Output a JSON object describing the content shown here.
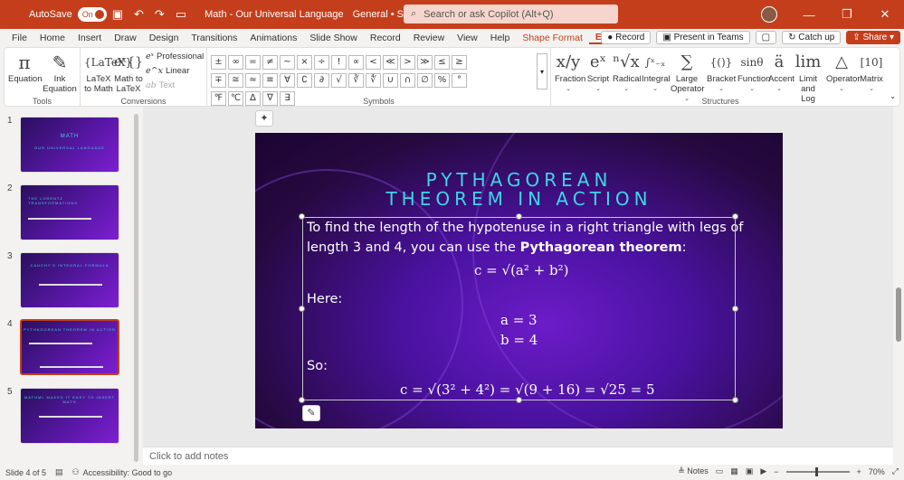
{
  "titlebar": {
    "autosave_label": "AutoSave",
    "autosave_state": "On",
    "doc_title": "Math - Our Universal Language",
    "sensitivity": "General • Saved",
    "search_placeholder": "Search or ask Copilot (Alt+Q)"
  },
  "tabs": [
    "File",
    "Home",
    "Insert",
    "Draw",
    "Design",
    "Transitions",
    "Animations",
    "Slide Show",
    "Record",
    "Review",
    "View",
    "Help",
    "Shape Format",
    "Equation"
  ],
  "active_tab": "Equation",
  "tab_actions": {
    "record": "Record",
    "teams": "Present in Teams",
    "catchup": "Catch up",
    "share": "Share"
  },
  "ribbon": {
    "tools": {
      "label": "Tools",
      "equation": "Equation",
      "ink_line1": "Ink",
      "ink_line2": "Equation"
    },
    "conversions": {
      "label": "Conversions",
      "latex_line1": "LaTeX",
      "latex_line2": "to Math",
      "mathtolatex_line1": "Math to",
      "mathtolatex_line2": "LaTeX",
      "professional": "Professional",
      "linear": "Linear",
      "text": "Text"
    },
    "symbols": {
      "label": "Symbols",
      "items": [
        "±",
        "∞",
        "=",
        "≠",
        "~",
        "×",
        "÷",
        "!",
        "∝",
        "<",
        "≪",
        ">",
        "≫",
        "≤",
        "≥",
        "∓",
        "≅",
        "≈",
        "≡",
        "∀",
        "∁",
        "∂",
        "√",
        "∛",
        "∜",
        "∪",
        "∩",
        "∅",
        "%",
        "°",
        "℉",
        "℃",
        "∆",
        "∇",
        "∃"
      ]
    },
    "structures": {
      "label": "Structures",
      "items": [
        {
          "icon": "x/y",
          "line1": "Fraction",
          "line2": ""
        },
        {
          "icon": "eˣ",
          "line1": "Script",
          "line2": ""
        },
        {
          "icon": "ⁿ√x",
          "line1": "Radical",
          "line2": ""
        },
        {
          "icon": "∫ˣ₋ₓ",
          "line1": "Integral",
          "line2": ""
        },
        {
          "icon": "∑",
          "line1": "Large",
          "line2": "Operator"
        },
        {
          "icon": "{()}",
          "line1": "Bracket",
          "line2": ""
        },
        {
          "icon": "sinθ",
          "line1": "Function",
          "line2": ""
        },
        {
          "icon": "ä",
          "line1": "Accent",
          "line2": ""
        },
        {
          "icon": "lim",
          "line1": "Limit and",
          "line2": "Log"
        },
        {
          "icon": "△",
          "line1": "Operator",
          "line2": ""
        },
        {
          "icon": "[10]",
          "line1": "Matrix",
          "line2": ""
        }
      ]
    }
  },
  "slides": [
    {
      "num": "1",
      "title": "MATH",
      "subtitle": "OUR UNIVERSAL LANGUAGE"
    },
    {
      "num": "2",
      "title": "THE LORENTZ TRANSFORMATIONS",
      "subtitle": ""
    },
    {
      "num": "3",
      "title": "CAUCHY'S INTEGRAL FORMULA",
      "subtitle": ""
    },
    {
      "num": "4",
      "title": "PYTHAGOREAN THEOREM IN ACTION",
      "subtitle": ""
    },
    {
      "num": "5",
      "title": "MATHML MAKES IT EASY TO INSERT MATH",
      "subtitle": ""
    }
  ],
  "current_slide": {
    "title_line1": "PYTHAGOREAN",
    "title_line2": "THEOREM IN ACTION",
    "intro_line1": "To find the length of the hypotenuse in a right triangle with legs of",
    "intro_line2_pre": "length 3 and 4, you can use the ",
    "intro_line2_bold": "Pythagorean theorem",
    "intro_line2_post": ":",
    "formula": "c = √(a² + b²)",
    "here": "Here:",
    "a_eq": "a = 3",
    "b_eq": "b = 4",
    "so": "So:",
    "result": "c = √(3² + 4²) = √(9 + 16) = √25 = 5"
  },
  "notes_placeholder": "Click to add notes",
  "status": {
    "slide_indicator": "Slide 4 of 5",
    "accessibility": "Accessibility: Good to go",
    "notes": "Notes",
    "zoom": "70%"
  }
}
